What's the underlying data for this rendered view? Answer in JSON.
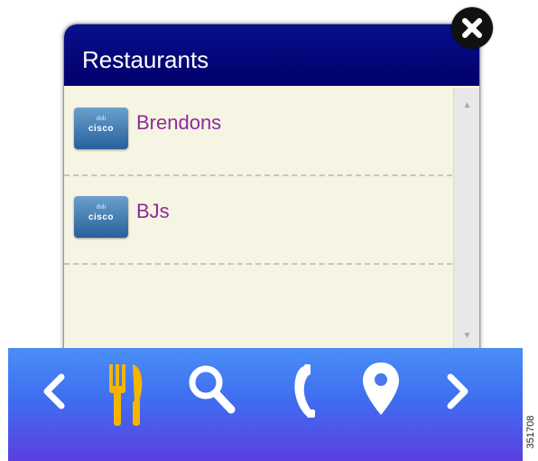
{
  "popup": {
    "title": "Restaurants",
    "items": [
      {
        "name": "Brendons",
        "logo_text": "cisco",
        "logo_bars": "ılıılı"
      },
      {
        "name": "BJs",
        "logo_text": "cisco",
        "logo_bars": "ılıılı"
      }
    ],
    "colors": {
      "header": "#00006b",
      "body": "#f6f4e2",
      "item_text": "#8c2c9c"
    }
  },
  "close_icon": "close-icon",
  "toolbar": {
    "icons": [
      "chevron-left-icon",
      "restaurant-icon",
      "search-icon",
      "phone-icon",
      "location-pin-icon",
      "chevron-right-icon"
    ],
    "active_icon": "restaurant-icon",
    "active_color": "#f5b400"
  },
  "figure_id": "351708"
}
